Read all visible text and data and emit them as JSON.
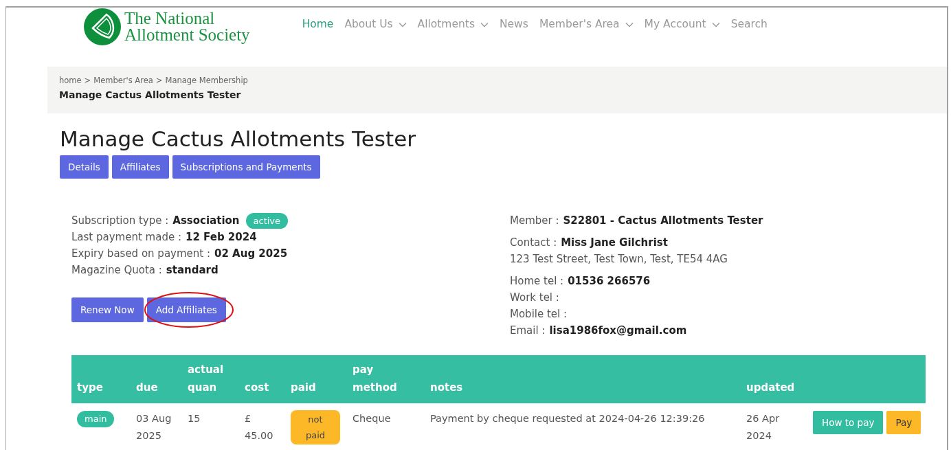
{
  "logo": {
    "line_1": "The National",
    "line_2": "Allotment Society"
  },
  "nav": [
    {
      "label": "Home",
      "selected": true,
      "dropdown": false
    },
    {
      "label": "About Us",
      "selected": false,
      "dropdown": true
    },
    {
      "label": "Allotments",
      "selected": false,
      "dropdown": true
    },
    {
      "label": "News",
      "selected": false,
      "dropdown": false
    },
    {
      "label": "Member's Area",
      "selected": false,
      "dropdown": true
    },
    {
      "label": "My Account",
      "selected": false,
      "dropdown": true
    },
    {
      "label": "Search",
      "selected": false,
      "dropdown": false
    }
  ],
  "breadcrumb": {
    "trail": [
      "home",
      "Member's Area",
      "Manage Membership"
    ],
    "separator": ">",
    "current": "Manage Cactus Allotments Tester"
  },
  "heading": "Manage Cactus Allotments Tester",
  "tabs": [
    "Details",
    "Affiliates",
    "Subscriptions and Payments"
  ],
  "subscription": [
    {
      "label": "Subscription type :",
      "value": "Association",
      "badge": "active"
    },
    {
      "label": "Last payment made :",
      "value": "12 Feb 2024"
    },
    {
      "label": "Expiry based on payment :",
      "value": "02 Aug 2025"
    },
    {
      "label": "Magazine Quota :",
      "value": "standard"
    }
  ],
  "actions": [
    {
      "label": "Renew Now",
      "circled": false
    },
    {
      "label": "Add Affiliates",
      "circled": true
    }
  ],
  "member": {
    "label": "Member :",
    "value": "S22801 - Cactus Allotments Tester"
  },
  "contact": {
    "label": "Contact :",
    "value": "Miss Jane Gilchrist",
    "address": "123 Test Street, Test Town, Test, TE54 4AG"
  },
  "phones": [
    {
      "label": "Home tel :",
      "value": "01536 266576"
    },
    {
      "label": "Work tel :"
    },
    {
      "label": "Mobile tel :"
    },
    {
      "label": "Email :",
      "value": "lisa1986fox@gmail.com"
    }
  ],
  "table": {
    "columns": [
      [
        "type"
      ],
      [
        "due"
      ],
      [
        "actual",
        "quan"
      ],
      [
        "cost"
      ],
      [
        "paid"
      ],
      [
        "pay",
        "method"
      ],
      [
        "notes"
      ],
      [
        "updated"
      ],
      []
    ],
    "rows": [
      {
        "type": "main",
        "due": [
          "03 Aug",
          "2025"
        ],
        "quan": "15",
        "cost": [
          "£",
          "45.00"
        ],
        "paid": false,
        "paid_label": [
          "not",
          "paid"
        ],
        "method": "Cheque",
        "notes": "Payment by cheque requested at 2024-04-26 12:39:26",
        "updated": [
          "26 Apr",
          "2024"
        ],
        "buttons": [
          "How to pay",
          "Pay"
        ]
      }
    ]
  }
}
